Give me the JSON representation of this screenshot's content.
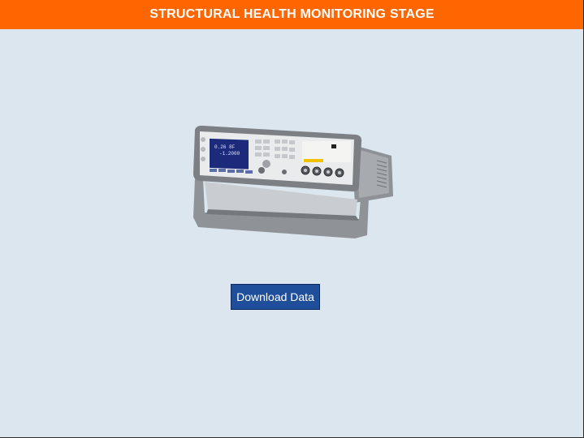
{
  "header": {
    "title": "STRUCTURAL HEALTH MONITORING STAGE",
    "color": "#ff6600"
  },
  "device_image": {
    "icon": "lcr-meter-instrument-image"
  },
  "actions": {
    "download_label": "Download Data",
    "button_color": "#1f4e9a"
  },
  "background_color": "#dce6ee"
}
